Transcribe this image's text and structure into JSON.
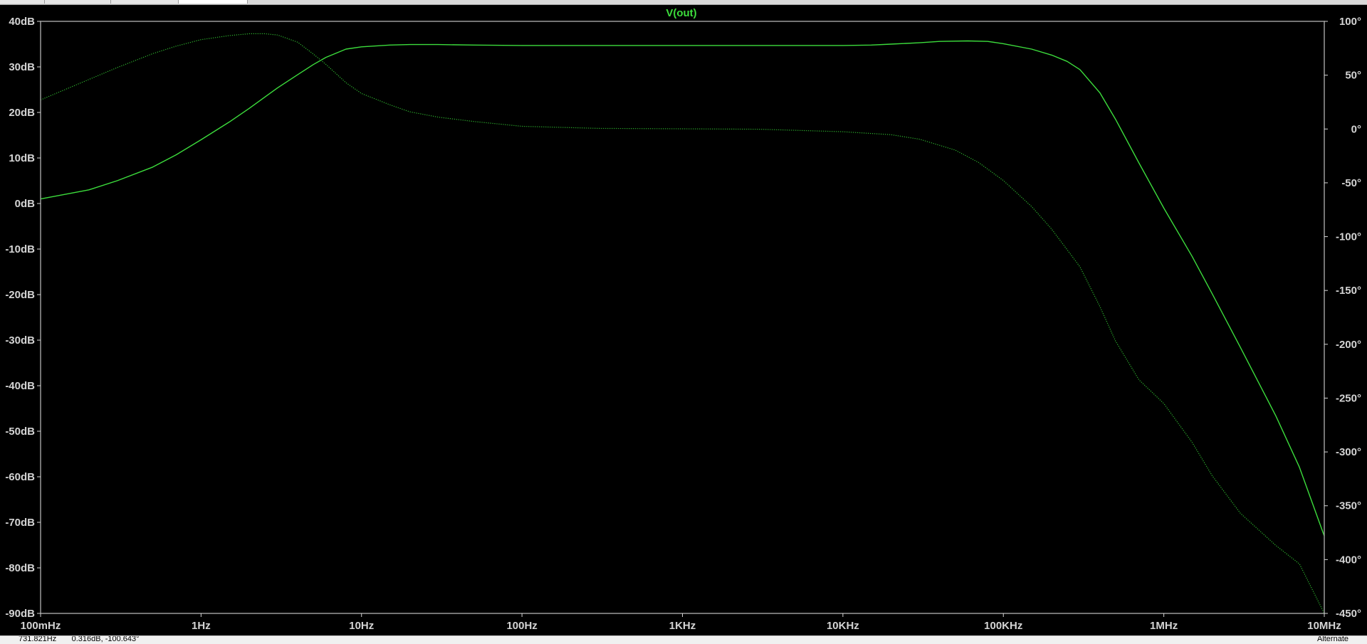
{
  "window": {
    "tabs": [
      "",
      "",
      "",
      ""
    ],
    "active_tab": 3
  },
  "status_bar": {
    "readout": "731.821Hz       0.316dB, -100.643°",
    "mode": "Alternate"
  },
  "colors": {
    "background": "#000000",
    "axis_text": "#d4d4d4",
    "trace": "#3cdc3c",
    "phase_trace": "#2fb52f",
    "title": "#3cdc3c"
  },
  "chart_data": {
    "type": "line",
    "title": "V(out)",
    "x_scale": "log",
    "xlim": [
      0.1,
      10000000
    ],
    "xlabel": "",
    "ylabel": "",
    "ylim": [
      -90,
      40
    ],
    "y2lim": [
      -450,
      100
    ],
    "grid": false,
    "legend": "none",
    "x_ticks": [
      {
        "value": 0.1,
        "label": "100mHz"
      },
      {
        "value": 1,
        "label": "1Hz"
      },
      {
        "value": 10,
        "label": "10Hz"
      },
      {
        "value": 100,
        "label": "100Hz"
      },
      {
        "value": 1000,
        "label": "1KHz"
      },
      {
        "value": 10000,
        "label": "10KHz"
      },
      {
        "value": 100000,
        "label": "100KHz"
      },
      {
        "value": 1000000,
        "label": "1MHz"
      },
      {
        "value": 10000000,
        "label": "10MHz"
      }
    ],
    "y_ticks": [
      {
        "value": 40,
        "label": "40dB"
      },
      {
        "value": 30,
        "label": "30dB"
      },
      {
        "value": 20,
        "label": "20dB"
      },
      {
        "value": 10,
        "label": "10dB"
      },
      {
        "value": 0,
        "label": "0dB"
      },
      {
        "value": -10,
        "label": "-10dB"
      },
      {
        "value": -20,
        "label": "-20dB"
      },
      {
        "value": -30,
        "label": "-30dB"
      },
      {
        "value": -40,
        "label": "-40dB"
      },
      {
        "value": -50,
        "label": "-50dB"
      },
      {
        "value": -60,
        "label": "-60dB"
      },
      {
        "value": -70,
        "label": "-70dB"
      },
      {
        "value": -80,
        "label": "-80dB"
      },
      {
        "value": -90,
        "label": "-90dB"
      }
    ],
    "y2_ticks": [
      {
        "value": 100,
        "label": "100°"
      },
      {
        "value": 50,
        "label": "50°"
      },
      {
        "value": 0,
        "label": "0°"
      },
      {
        "value": -50,
        "label": "-50°"
      },
      {
        "value": -100,
        "label": "-100°"
      },
      {
        "value": -150,
        "label": "-150°"
      },
      {
        "value": -200,
        "label": "-200°"
      },
      {
        "value": -250,
        "label": "-250°"
      },
      {
        "value": -300,
        "label": "-300°"
      },
      {
        "value": -350,
        "label": "-350°"
      },
      {
        "value": -400,
        "label": "-400°"
      },
      {
        "value": -450,
        "label": "-450°"
      }
    ],
    "series": [
      {
        "axis": "left",
        "style": "solid",
        "x": [
          0.1,
          0.2,
          0.3,
          0.5,
          0.7,
          1,
          1.5,
          2,
          3,
          4,
          5,
          6,
          8,
          10,
          15,
          20,
          30,
          50,
          100,
          300,
          1000,
          3000,
          10000,
          15000,
          20000,
          30000,
          40000,
          60000,
          80000,
          100000,
          150000,
          200000,
          250000,
          300000,
          400000,
          500000,
          700000,
          1000000,
          1500000,
          2000000,
          3000000,
          5000000,
          7000000,
          10000000
        ],
        "y": [
          1,
          3,
          5,
          8,
          10.7,
          14,
          17.9,
          20.9,
          25.4,
          28.3,
          30.5,
          32.1,
          33.9,
          34.4,
          34.8,
          34.9,
          34.9,
          34.8,
          34.7,
          34.7,
          34.7,
          34.7,
          34.7,
          34.8,
          35.0,
          35.3,
          35.6,
          35.7,
          35.6,
          35.1,
          33.9,
          32.6,
          31.2,
          29.4,
          24.3,
          18.5,
          8.9,
          -1,
          -11.6,
          -19.8,
          -31.6,
          -46.7,
          -57.9,
          -73
        ]
      },
      {
        "axis": "right",
        "style": "dotted",
        "x": [
          0.1,
          0.2,
          0.3,
          0.5,
          0.7,
          1,
          1.5,
          2,
          2.5,
          3,
          4,
          5,
          6,
          8,
          10,
          15,
          20,
          30,
          50,
          100,
          300,
          1000,
          3000,
          10000,
          20000,
          30000,
          50000,
          70000,
          100000,
          150000,
          200000,
          300000,
          400000,
          500000,
          700000,
          1000000,
          1500000,
          2000000,
          3000000,
          5000000,
          7000000,
          10000000
        ],
        "y": [
          27,
          46,
          57,
          70,
          77,
          83,
          86.8,
          88.5,
          88.5,
          87.3,
          80.6,
          69.7,
          60,
          43,
          33,
          22.5,
          16,
          11,
          7,
          2.5,
          0.6,
          0.2,
          -0.2,
          -2.5,
          -5.3,
          -9.5,
          -19.5,
          -31,
          -47.9,
          -72,
          -93,
          -128,
          -165,
          -197,
          -233,
          -255,
          -291,
          -322,
          -357,
          -387,
          -404,
          -450
        ]
      }
    ]
  }
}
